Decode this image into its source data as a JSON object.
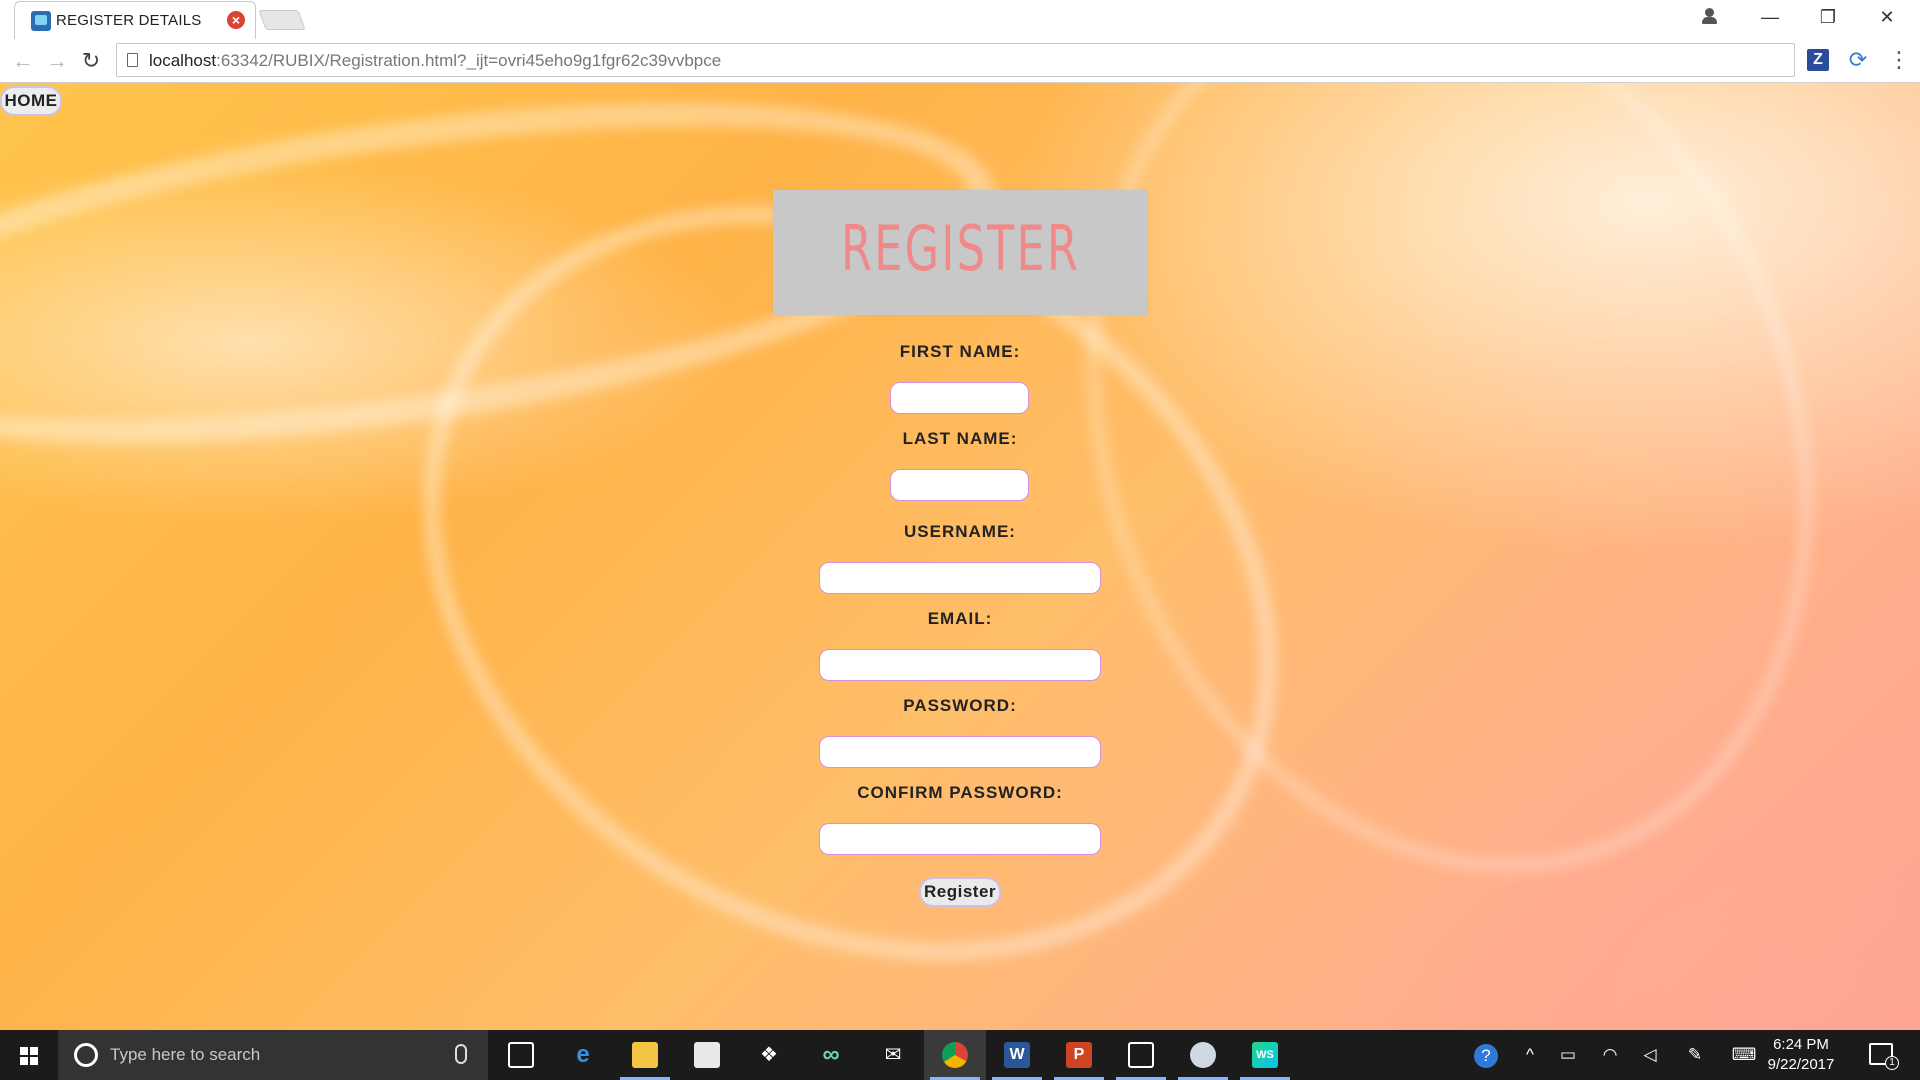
{
  "browser": {
    "tab_title": "REGISTER DETAILS",
    "url_host": "localhost",
    "url_rest": ":63342/RUBIX/Registration.html?_ijt=ovri45eho9g1fgr62c39vvbpce",
    "window_controls": {
      "minimize": "—",
      "restore": "❐",
      "close": "✕"
    }
  },
  "page": {
    "home_label": "HOME",
    "banner_title": "REGISTER",
    "fields": [
      {
        "label": "FIRST NAME:",
        "value": ""
      },
      {
        "label": "LAST NAME:",
        "value": ""
      },
      {
        "label": "USERNAME:",
        "value": ""
      },
      {
        "label": "EMAIL:",
        "value": ""
      },
      {
        "label": "PASSWORD:",
        "value": ""
      },
      {
        "label": "CONFIRM PASSWORD:",
        "value": ""
      }
    ],
    "submit_label": "Register",
    "colors": {
      "banner_bg": "#c8c8c8",
      "banner_text": "#f08a8a",
      "input_border": "#d88fe0",
      "background": [
        "#ffc54d",
        "#ffa192"
      ]
    }
  },
  "taskbar": {
    "search_placeholder": "Type here to search",
    "apps": [
      "task-view",
      "edge",
      "file-explorer",
      "store",
      "dropbox",
      "infinity",
      "mail",
      "chrome",
      "word",
      "powerpoint",
      "photos",
      "paint",
      "webstorm"
    ],
    "time": "6:24 PM",
    "date": "9/22/2017",
    "notification_count": "1"
  }
}
